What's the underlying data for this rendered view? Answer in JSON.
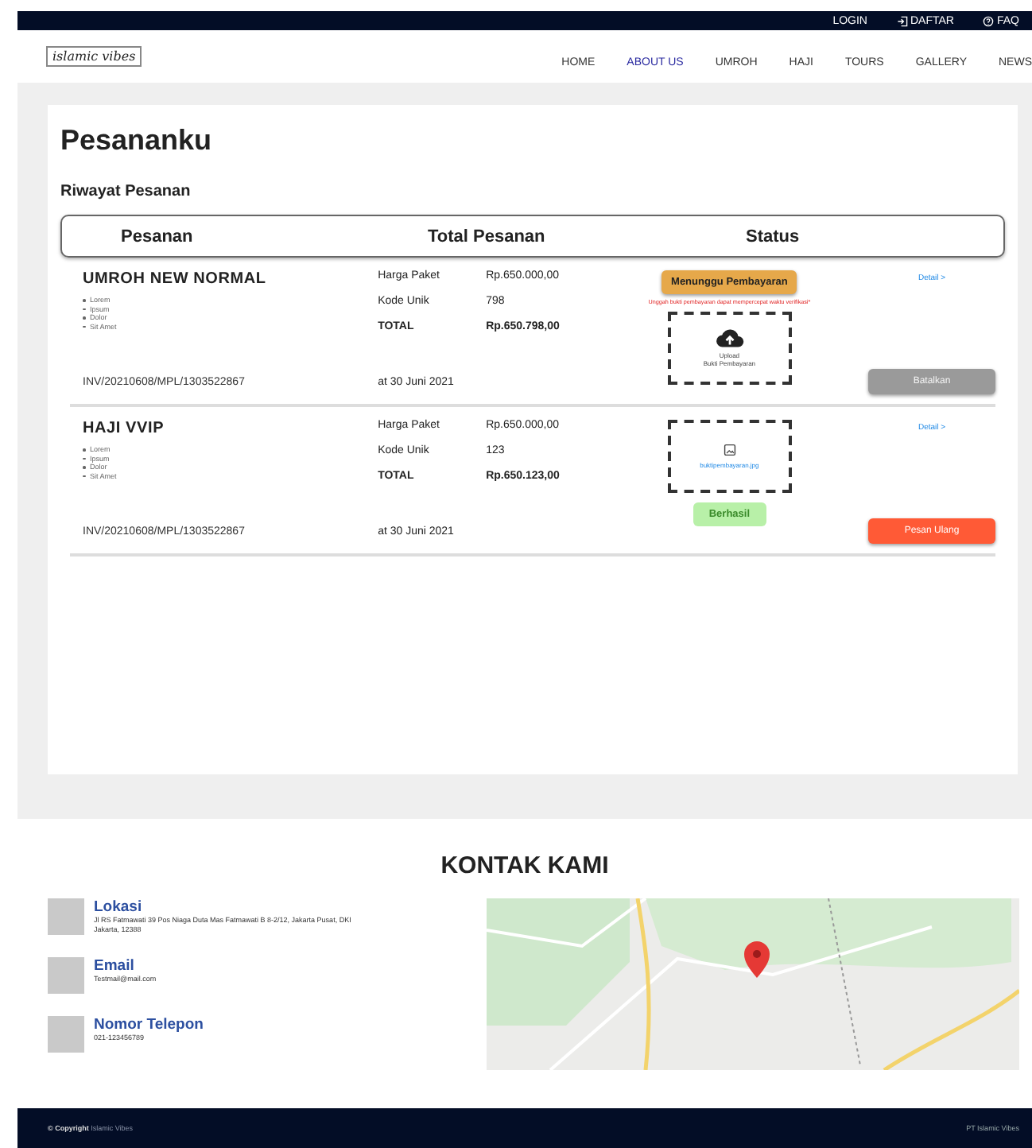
{
  "topbar": {
    "links": [
      {
        "label": "LOGIN"
      },
      {
        "label": "DAFTAR"
      },
      {
        "label": "FAQ"
      }
    ]
  },
  "navbar": {
    "logo": "islamic vibes",
    "items": [
      {
        "label": "HOME",
        "selected": false
      },
      {
        "label": "ABOUT US",
        "selected": true
      },
      {
        "label": "UMROH",
        "selected": false
      },
      {
        "label": "HAJI",
        "selected": false
      },
      {
        "label": "TOURS",
        "selected": false
      },
      {
        "label": "GALLERY",
        "selected": false
      },
      {
        "label": "NEWS",
        "selected": false
      }
    ]
  },
  "page_title": "Pesananku",
  "section_title": "Riwayat Pesanan",
  "table": {
    "columns": [
      "Pesanan",
      "Total Pesanan",
      "Status"
    ],
    "rows": [
      {
        "name": "UMROH NEW NORMAL",
        "features": [
          "Lorem",
          "Ipsum",
          "Dolor",
          "Sit Amet"
        ],
        "invoice": "INV/20210608/MPL/1303522867",
        "date": "at 30 Juni 2021",
        "prices": [
          {
            "label": "Harga Paket",
            "value": "Rp.650.000,00",
            "total": false
          },
          {
            "label": "Kode Unik",
            "value": "798",
            "total": false
          },
          {
            "label": "TOTAL",
            "value": "Rp.650.798,00",
            "total": true
          }
        ],
        "status": {
          "label": "Menunggu Pembayaran",
          "kind": "pending"
        },
        "note": "Unggah bukti pembayaran dapat mempercepat waktu verifikasi*",
        "upload": {
          "kind": "upload",
          "lines": [
            "Upload",
            "Bukti Pembayaran"
          ]
        },
        "detail": "Detail >",
        "action": {
          "label": "Batalkan",
          "disabled": true
        }
      },
      {
        "name": "HAJI VVIP",
        "features": [
          "Lorem",
          "Ipsum",
          "Dolor",
          "Sit Amet"
        ],
        "invoice": "INV/20210608/MPL/1303522867",
        "date": "at 30 Juni 2021",
        "prices": [
          {
            "label": "Harga Paket",
            "value": "Rp.650.000,00",
            "total": false
          },
          {
            "label": "Kode Unik",
            "value": "123",
            "total": false
          },
          {
            "label": "TOTAL",
            "value": "Rp.650.123,00",
            "total": true
          }
        ],
        "status": {
          "label": "Berhasil",
          "kind": "success"
        },
        "upload": {
          "kind": "file",
          "lines": [
            "buktipembayaran.jpg"
          ]
        },
        "detail": "Detail >",
        "action": {
          "label": "Pesan Ulang",
          "disabled": false
        }
      }
    ]
  },
  "contact": {
    "title": "KONTAK KAMI",
    "items": [
      {
        "label": "Lokasi",
        "value": "Jl RS Fatmawati 39 Pos Niaga Duta Mas Fatmawati B 8-2/12, Jakarta Pusat, DKI Jakarta, 12388"
      },
      {
        "label": "Email",
        "value": "Testmail@mail.com"
      },
      {
        "label": "Nomor Telepon",
        "value": "021-123456789"
      }
    ]
  },
  "footer": {
    "copyright_label": "© Copyright",
    "copyright_name": "Islamic Vibes",
    "company": "PT Islamic Vibes"
  }
}
